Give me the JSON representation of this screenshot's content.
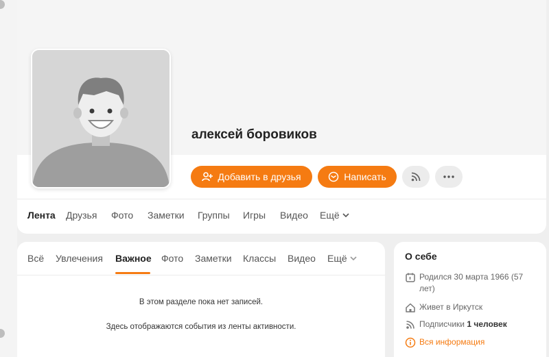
{
  "profile": {
    "name": "алексей боровиков"
  },
  "actions": {
    "add_friend": "Добавить в друзья",
    "write": "Написать"
  },
  "nav": {
    "items": [
      "Лента",
      "Друзья",
      "Фото",
      "Заметки",
      "Группы",
      "Игры",
      "Видео",
      "Ещё"
    ]
  },
  "feed": {
    "tabs": [
      "Всё",
      "Увлечения",
      "Важное",
      "Фото",
      "Заметки",
      "Классы",
      "Видео",
      "Ещё"
    ],
    "empty_title": "В этом разделе пока нет записей.",
    "empty_text": "Здесь отображаются события из ленты активности."
  },
  "about": {
    "title": "О себе",
    "born": "Родился 30 марта 1966 (57",
    "born_cont": "лет)",
    "lives": "Живет в Иркутск",
    "followers_label": "Подписчики",
    "followers_count": "1 человек",
    "all_info": "Вся информация"
  },
  "colors": {
    "accent": "#f57b12",
    "background": "#efefef"
  },
  "icons": [
    "add-friend-icon",
    "mail-icon",
    "rss-icon",
    "more-icon",
    "chevron-down-icon",
    "calendar-icon",
    "home-icon",
    "rss-icon",
    "info-icon"
  ]
}
